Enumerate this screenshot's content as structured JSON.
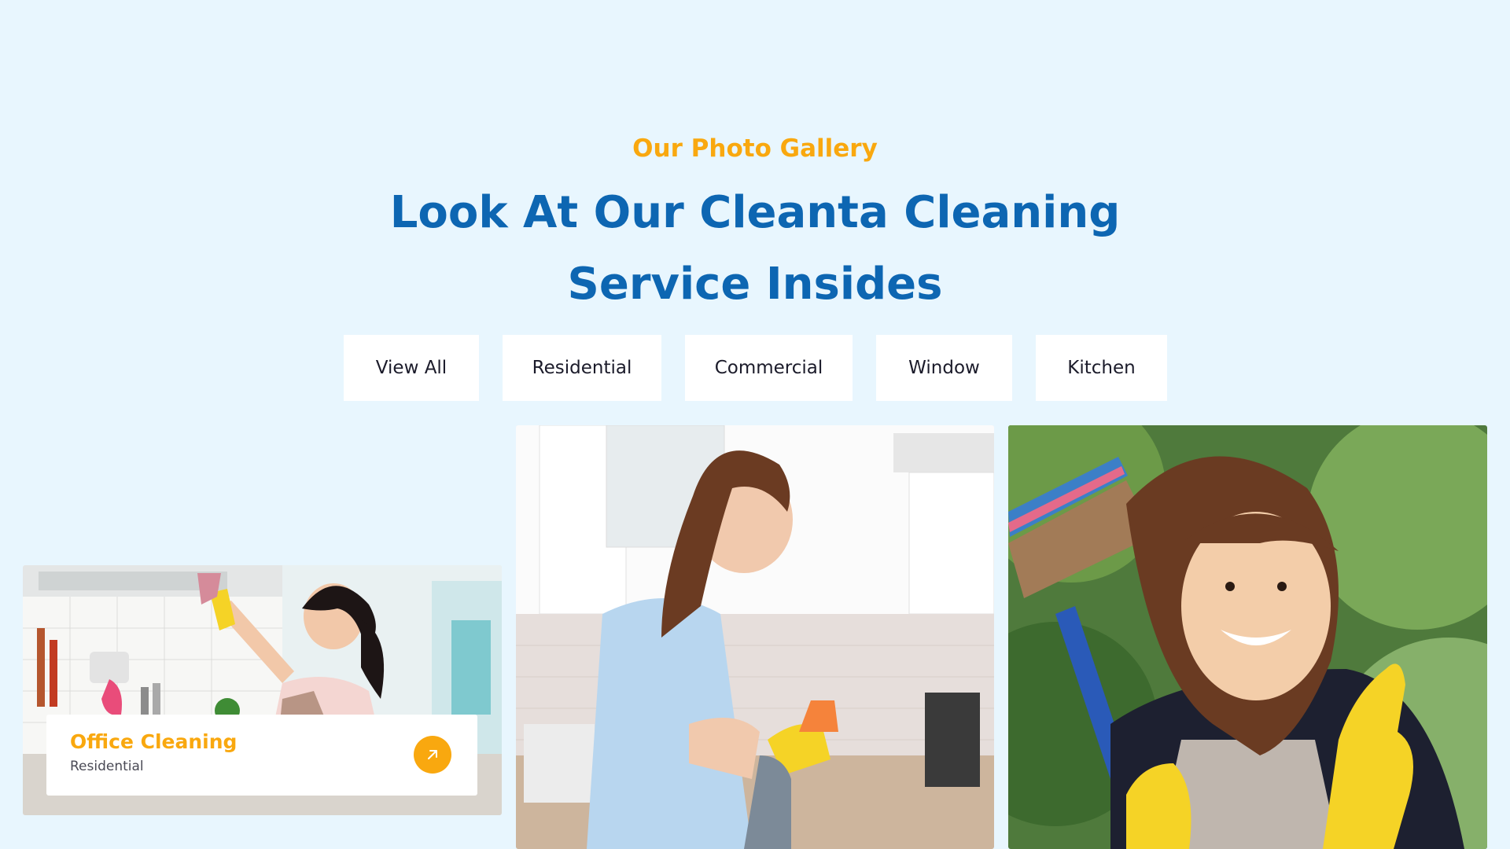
{
  "section": {
    "subtitle": "Our Photo Gallery",
    "headline_line1": "Look At Our Cleanta Cleaning",
    "headline_line2": "Service Insides"
  },
  "filters": [
    {
      "label": "View All"
    },
    {
      "label": "Residential"
    },
    {
      "label": "Commercial"
    },
    {
      "label": "Window"
    },
    {
      "label": "Kitchen"
    }
  ],
  "gallery": {
    "items": [
      {
        "image": "woman-cleaning-kitchen-cabinet-photo",
        "caption_title": "Office Cleaning",
        "caption_category": "Residential",
        "action_icon": "arrow-up-right-icon"
      },
      {
        "image": "woman-spraying-kitchen-counter-photo"
      },
      {
        "image": "smiling-woman-with-broom-thumbs-up-photo"
      }
    ]
  },
  "colors": {
    "background": "#e8f6fe",
    "accent": "#f9a80f",
    "heading": "#0d66b2",
    "button_bg": "#ffffff"
  }
}
